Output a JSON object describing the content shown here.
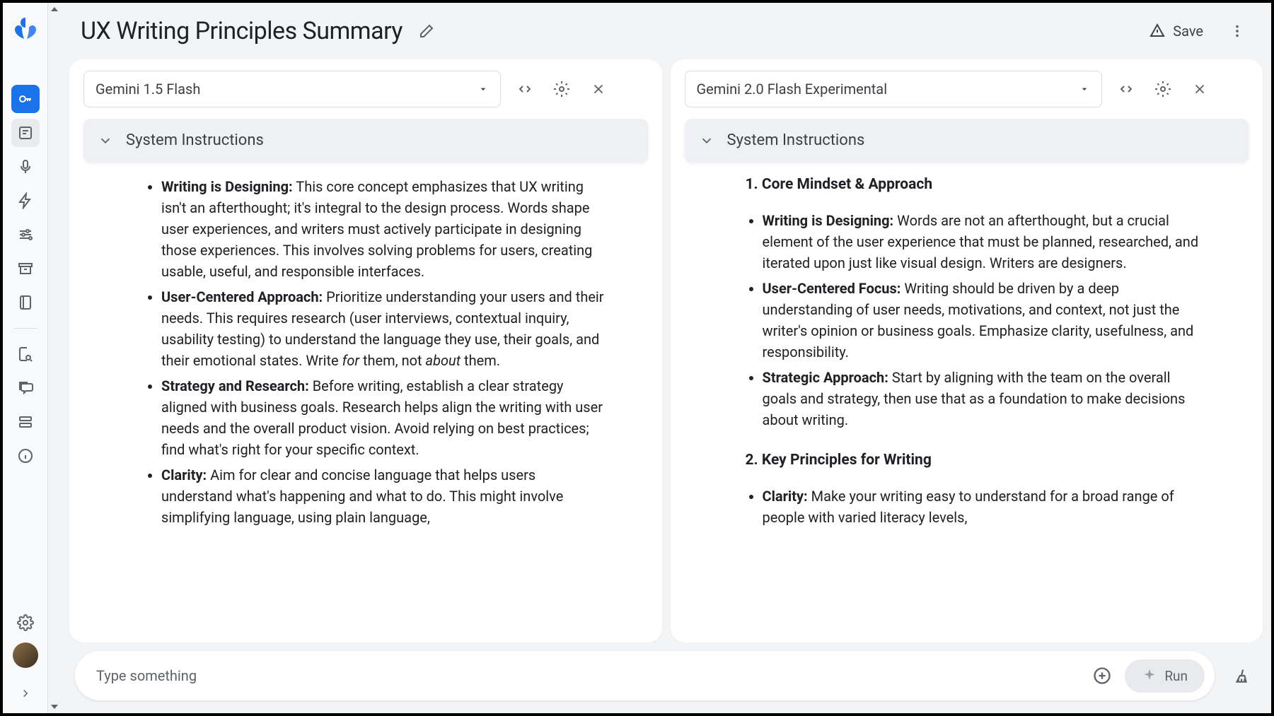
{
  "header": {
    "title": "UX Writing Principles Summary",
    "save_label": "Save"
  },
  "panes": {
    "left": {
      "model": "Gemini 1.5 Flash",
      "system_instructions_label": "System Instructions",
      "content": [
        {
          "bold": "Writing is Designing:",
          "text": " This core concept emphasizes that UX writing isn't an afterthought; it's integral to the design process. Words shape user experiences, and writers must actively participate in designing those experiences. This involves solving problems for users, creating usable, useful, and responsible interfaces."
        },
        {
          "bold": "User-Centered Approach:",
          "text_pre": " Prioritize understanding your users and their needs. This requires research (user interviews, contextual inquiry, usability testing) to understand the language they use, their goals, and their emotional states. Write ",
          "italic1": "for",
          "text_mid": " them, not ",
          "italic2": "about",
          "text_post": " them."
        },
        {
          "bold": "Strategy and Research:",
          "text": " Before writing, establish a clear strategy aligned with business goals. Research helps align the writing with user needs and the overall product vision. Avoid relying on best practices; find what's right for your specific context."
        },
        {
          "bold": "Clarity:",
          "text": " Aim for clear and concise language that helps users understand what's happening and what to do. This might involve simplifying language, using plain language,"
        }
      ]
    },
    "right": {
      "model": "Gemini 2.0 Flash Experimental",
      "system_instructions_label": "System Instructions",
      "section1_heading": "1. Core Mindset & Approach",
      "section1_items": [
        {
          "bold": "Writing is Designing:",
          "text": " Words are not an afterthought, but a crucial element of the user experience that must be planned, researched, and iterated upon just like visual design. Writers are designers."
        },
        {
          "bold": "User-Centered Focus:",
          "text": " Writing should be driven by a deep understanding of user needs, motivations, and context, not just the writer's opinion or business goals. Emphasize clarity, usefulness, and responsibility."
        },
        {
          "bold": "Strategic Approach:",
          "text": " Start by aligning with the team on the overall goals and strategy, then use that as a foundation to make decisions about writing."
        }
      ],
      "section2_heading": "2. Key Principles for Writing",
      "section2_items": [
        {
          "bold": "Clarity:",
          "text": " Make your writing easy to understand for a broad range of people with varied literacy levels,"
        }
      ]
    }
  },
  "input": {
    "placeholder": "Type something",
    "run_label": "Run"
  }
}
